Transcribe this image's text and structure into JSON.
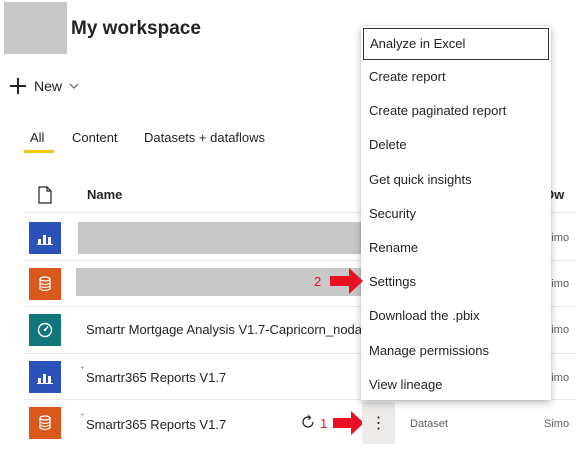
{
  "workspace": {
    "title": "My workspace"
  },
  "toolbar": {
    "new_label": "New"
  },
  "tabs": [
    {
      "label": "All",
      "active": true
    },
    {
      "label": "Content",
      "active": false
    },
    {
      "label": "Datasets + dataflows",
      "active": false
    }
  ],
  "table": {
    "columns": {
      "name": "Name",
      "owner": "Ow"
    },
    "rows": [
      {
        "icon": "report-icon",
        "name": "",
        "owner": "Simo"
      },
      {
        "icon": "dataset-icon",
        "name": "",
        "owner": "Simo"
      },
      {
        "icon": "dashboard-icon",
        "name": "Smartr Mortgage Analysis V1.7-Capricorn_noda",
        "owner": "Simo"
      },
      {
        "icon": "report-icon",
        "name": "Smartr365 Reports V1.7",
        "owner": "Simo"
      },
      {
        "icon": "dataset-icon",
        "name": "Smartr365 Reports V1.7",
        "type": "Dataset",
        "owner": "Simo"
      }
    ]
  },
  "context_menu": {
    "items": [
      "Analyze in Excel",
      "Create report",
      "Create paginated report",
      "Delete",
      "Get quick insights",
      "Security",
      "Rename",
      "Settings",
      "Download the .pbix",
      "Manage permissions",
      "View lineage"
    ],
    "focused_index": 0
  },
  "annotations": {
    "step1": "1",
    "step2": "2"
  },
  "colors": {
    "accent_yellow": "#f2c811",
    "report_blue": "#2b52b8",
    "dataset_orange": "#d9581b",
    "dashboard_teal": "#10767a",
    "annotation_red": "#e81123"
  }
}
